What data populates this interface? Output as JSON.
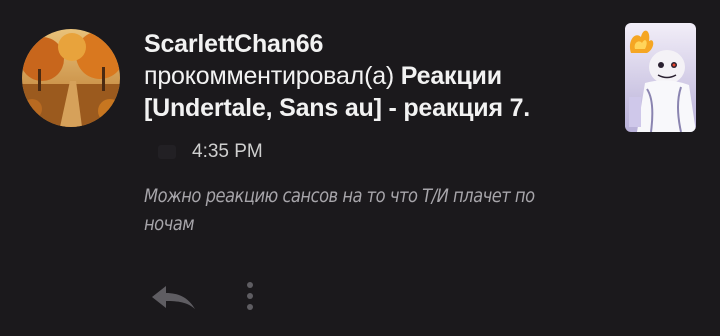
{
  "notification": {
    "username": "ScarlettChan66",
    "action_text": "прокомментировал(а) ",
    "story_title": "Реакции [Undertale, Sans au] - реакция 7.",
    "time": "4:35 PM",
    "comment": "Можно реакцию сансов на то что Т/И плачет по ночам"
  },
  "icons": {
    "avatar": "autumn-road-avatar",
    "clock": "clock-icon",
    "reply": "reply-icon",
    "more": "more-vertical-icon",
    "thumbnail": "story-cover-thumbnail"
  },
  "colors": {
    "background": "#1b191c",
    "text": "#f2f2f2",
    "muted": "#a7a5aa",
    "icon": "#5f5d62"
  }
}
